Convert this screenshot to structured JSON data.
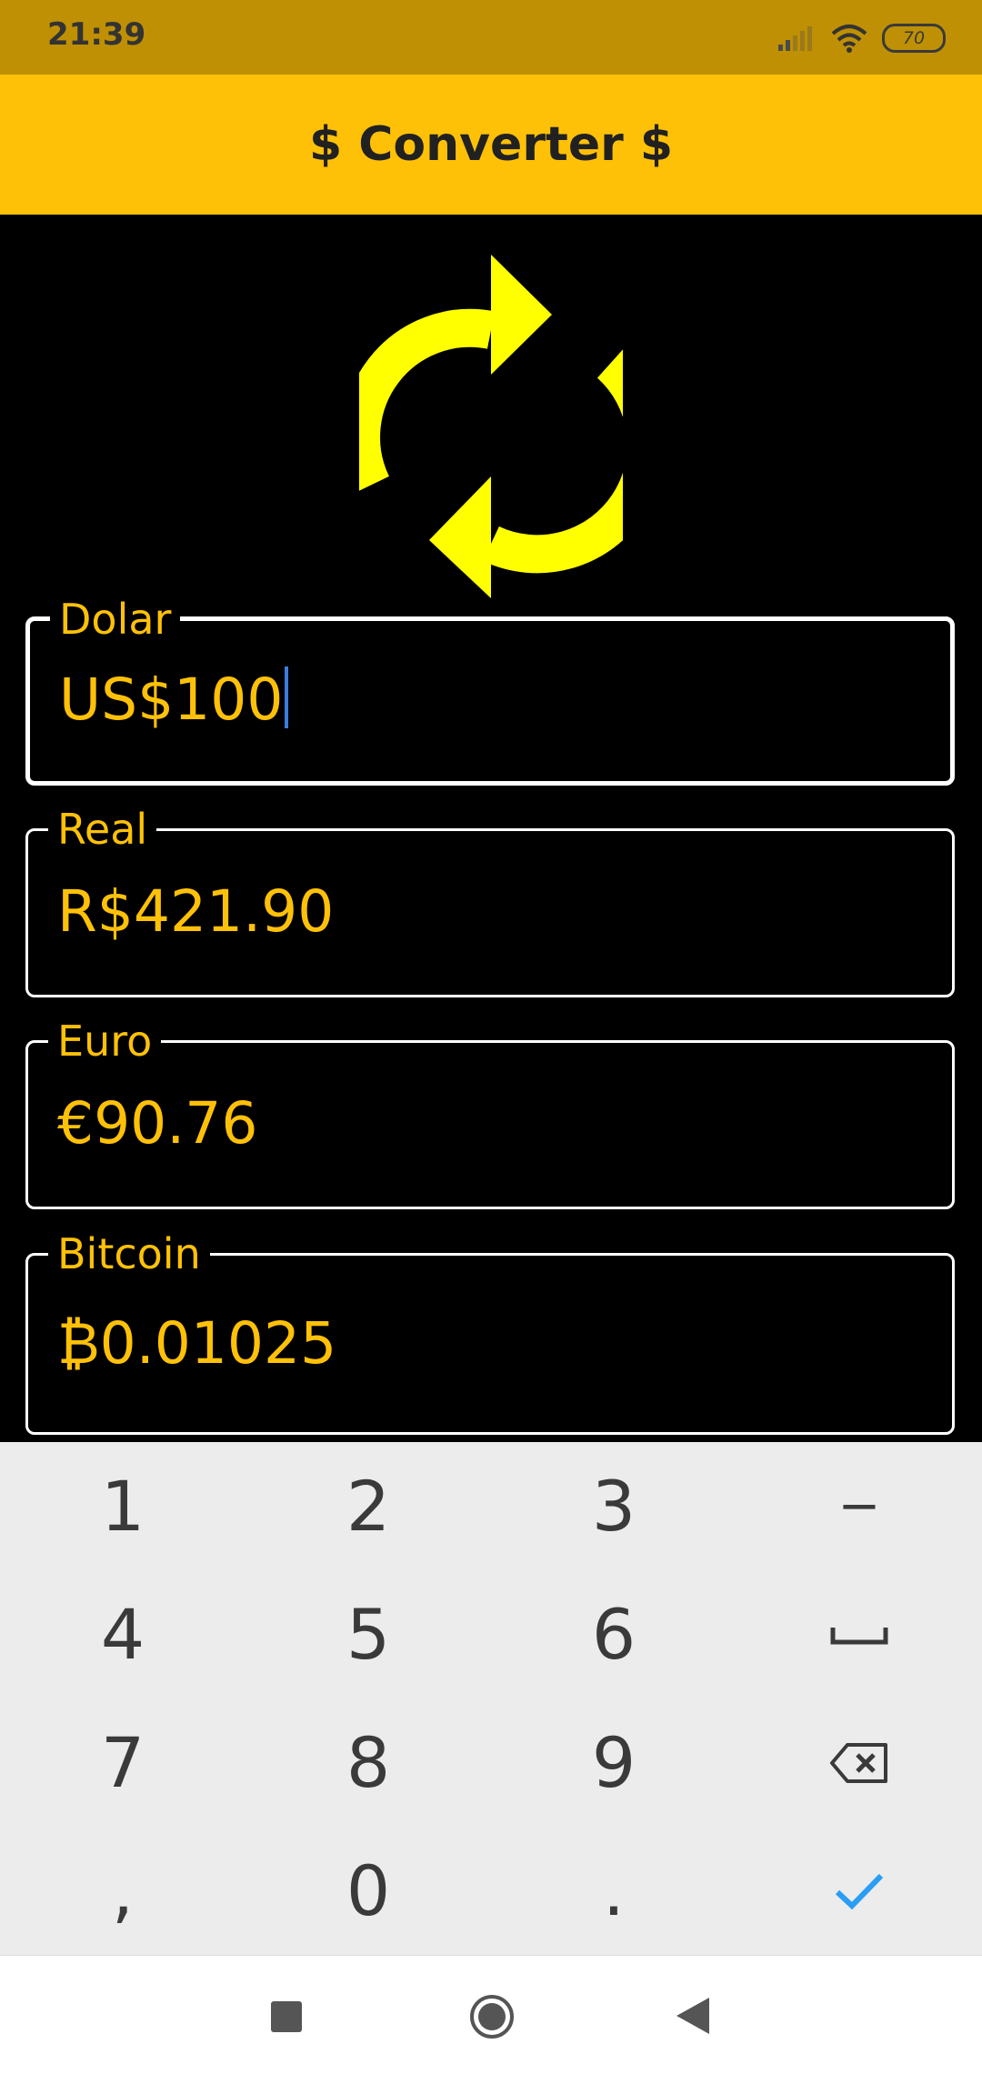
{
  "status_bar": {
    "time": "21:39",
    "battery": "70"
  },
  "app_bar": {
    "title": "$ Converter $"
  },
  "fields": {
    "dolar": {
      "label": "Dolar",
      "value": "US$100"
    },
    "real": {
      "label": "Real",
      "value": "R$421.90"
    },
    "euro": {
      "label": "Euro",
      "value": "€90.76"
    },
    "bitcoin": {
      "label": "Bitcoin",
      "value": "₿0.01025"
    }
  },
  "keyboard": {
    "row1": [
      "1",
      "2",
      "3",
      "−"
    ],
    "row2": [
      "4",
      "5",
      "6"
    ],
    "row3": [
      "7",
      "8",
      "9"
    ],
    "row4": [
      ",",
      "0",
      "."
    ]
  },
  "colors": {
    "accent": "#FFC107",
    "status_bar": "#BF9003",
    "icon": "#FFFF00",
    "background": "#000000"
  }
}
